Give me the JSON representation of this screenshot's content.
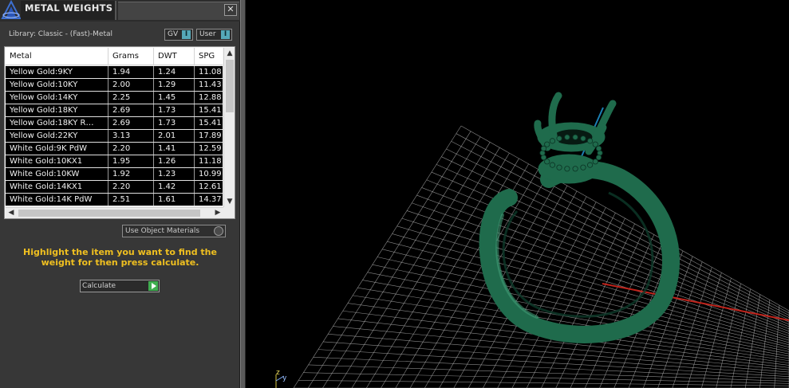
{
  "panel": {
    "title": "METAL WEIGHTS",
    "close_glyph": "✕",
    "library_label": "Library: Classic - (Fast)-Metal",
    "gv_toggle": "GV",
    "user_toggle": "User",
    "toggle_glyph": "I",
    "use_object_materials": "Use Object Materials",
    "hint": "Highlight the item you want to find the weight for then press calculate.",
    "calculate_label": "Calculate"
  },
  "table": {
    "columns": [
      "Metal",
      "Grams",
      "DWT",
      "SPG"
    ],
    "rows": [
      [
        "Yellow Gold:9KY",
        "1.94",
        "1.24",
        "11.08"
      ],
      [
        "Yellow Gold:10KY",
        "2.00",
        "1.29",
        "11.43"
      ],
      [
        "Yellow Gold:14KY",
        "2.25",
        "1.45",
        "12.88"
      ],
      [
        "Yellow Gold:18KY",
        "2.69",
        "1.73",
        "15.41"
      ],
      [
        "Yellow Gold:18KY R…",
        "2.69",
        "1.73",
        "15.41"
      ],
      [
        "Yellow Gold:22KY",
        "3.13",
        "2.01",
        "17.89"
      ],
      [
        "White Gold:9K PdW",
        "2.20",
        "1.41",
        "12.59"
      ],
      [
        "White Gold:10KX1",
        "1.95",
        "1.26",
        "11.18"
      ],
      [
        "White Gold:10KW",
        "1.92",
        "1.23",
        "10.99"
      ],
      [
        "White Gold:14KX1",
        "2.20",
        "1.42",
        "12.61"
      ],
      [
        "White Gold:14K PdW",
        "2.51",
        "1.61",
        "14.37"
      ]
    ],
    "scroll_up": "▲",
    "scroll_down": "▼",
    "scroll_left": "◀",
    "scroll_right": "▶"
  },
  "viewport": {
    "axis_label_z": "z",
    "axis_label_y": "y",
    "ring_color": "#1f6b4c",
    "grid_color": "#b8b8b8",
    "x_axis_color": "#c0231b",
    "y_axis_color": "#1b7fb3"
  }
}
